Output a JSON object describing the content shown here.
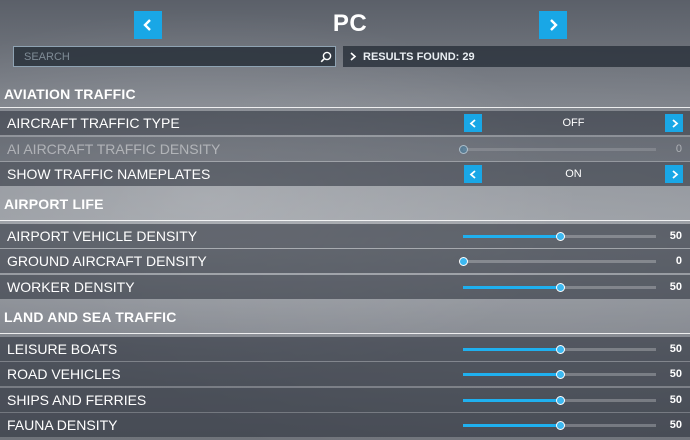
{
  "header": {
    "title": "PC"
  },
  "search": {
    "placeholder": "SEARCH",
    "value": ""
  },
  "results": {
    "label": "RESULTS FOUND: 29"
  },
  "colors": {
    "accent": "#19a7e6"
  },
  "sections": [
    {
      "title": "AVIATION TRAFFIC",
      "rows": [
        {
          "label": "AIRCRAFT TRAFFIC TYPE",
          "control": "cycler",
          "value": "OFF"
        },
        {
          "label": "AI AIRCRAFT TRAFFIC DENSITY",
          "control": "slider",
          "value": 0,
          "max": 100,
          "display": "0",
          "disabled": true
        },
        {
          "label": "SHOW TRAFFIC NAMEPLATES",
          "control": "cycler",
          "value": "ON"
        }
      ]
    },
    {
      "title": "AIRPORT LIFE",
      "rows": [
        {
          "label": "AIRPORT VEHICLE DENSITY",
          "control": "slider",
          "value": 50,
          "max": 100,
          "display": "50"
        },
        {
          "label": "GROUND AIRCRAFT DENSITY",
          "control": "slider",
          "value": 0,
          "max": 100,
          "display": "0"
        },
        {
          "label": "WORKER DENSITY",
          "control": "slider",
          "value": 50,
          "max": 100,
          "display": "50"
        }
      ]
    },
    {
      "title": "LAND AND SEA TRAFFIC",
      "rows": [
        {
          "label": "LEISURE BOATS",
          "control": "slider",
          "value": 50,
          "max": 100,
          "display": "50"
        },
        {
          "label": "ROAD VEHICLES",
          "control": "slider",
          "value": 50,
          "max": 100,
          "display": "50"
        },
        {
          "label": "SHIPS AND FERRIES",
          "control": "slider",
          "value": 50,
          "max": 100,
          "display": "50"
        },
        {
          "label": "FAUNA DENSITY",
          "control": "slider",
          "value": 50,
          "max": 100,
          "display": "50"
        }
      ]
    }
  ]
}
